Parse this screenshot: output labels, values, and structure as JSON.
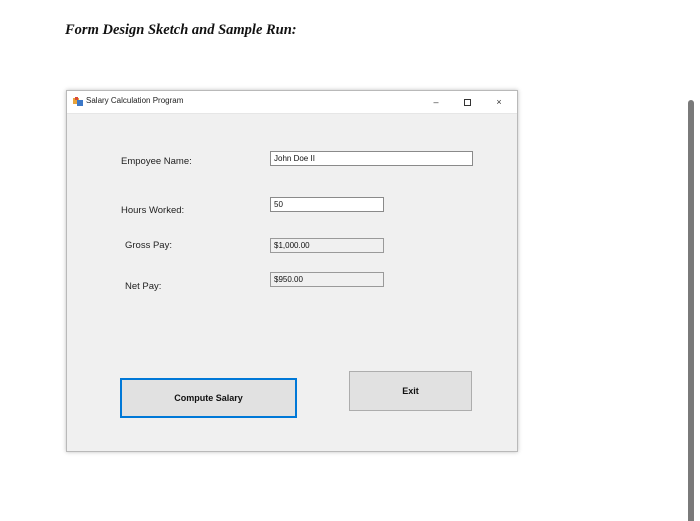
{
  "document": {
    "heading": "Form Design Sketch and Sample Run:"
  },
  "window": {
    "title": "Salary Calculation Program",
    "icon": "app-form-icon",
    "controls": {
      "minimize": "–",
      "close": "×"
    }
  },
  "form": {
    "employee_name": {
      "label": "Empoyee Name:",
      "value": "John Doe II"
    },
    "hours_worked": {
      "label": "Hours Worked:",
      "value": "50"
    },
    "gross_pay": {
      "label": "Gross Pay:",
      "value": "$1,000.00"
    },
    "net_pay": {
      "label": "Net Pay:",
      "value": "$950.00"
    }
  },
  "buttons": {
    "compute": "Compute Salary",
    "exit": "Exit"
  },
  "colors": {
    "focus_border": "#0078d7",
    "form_background": "#f0f0f0",
    "button_face": "#e1e1e1"
  }
}
